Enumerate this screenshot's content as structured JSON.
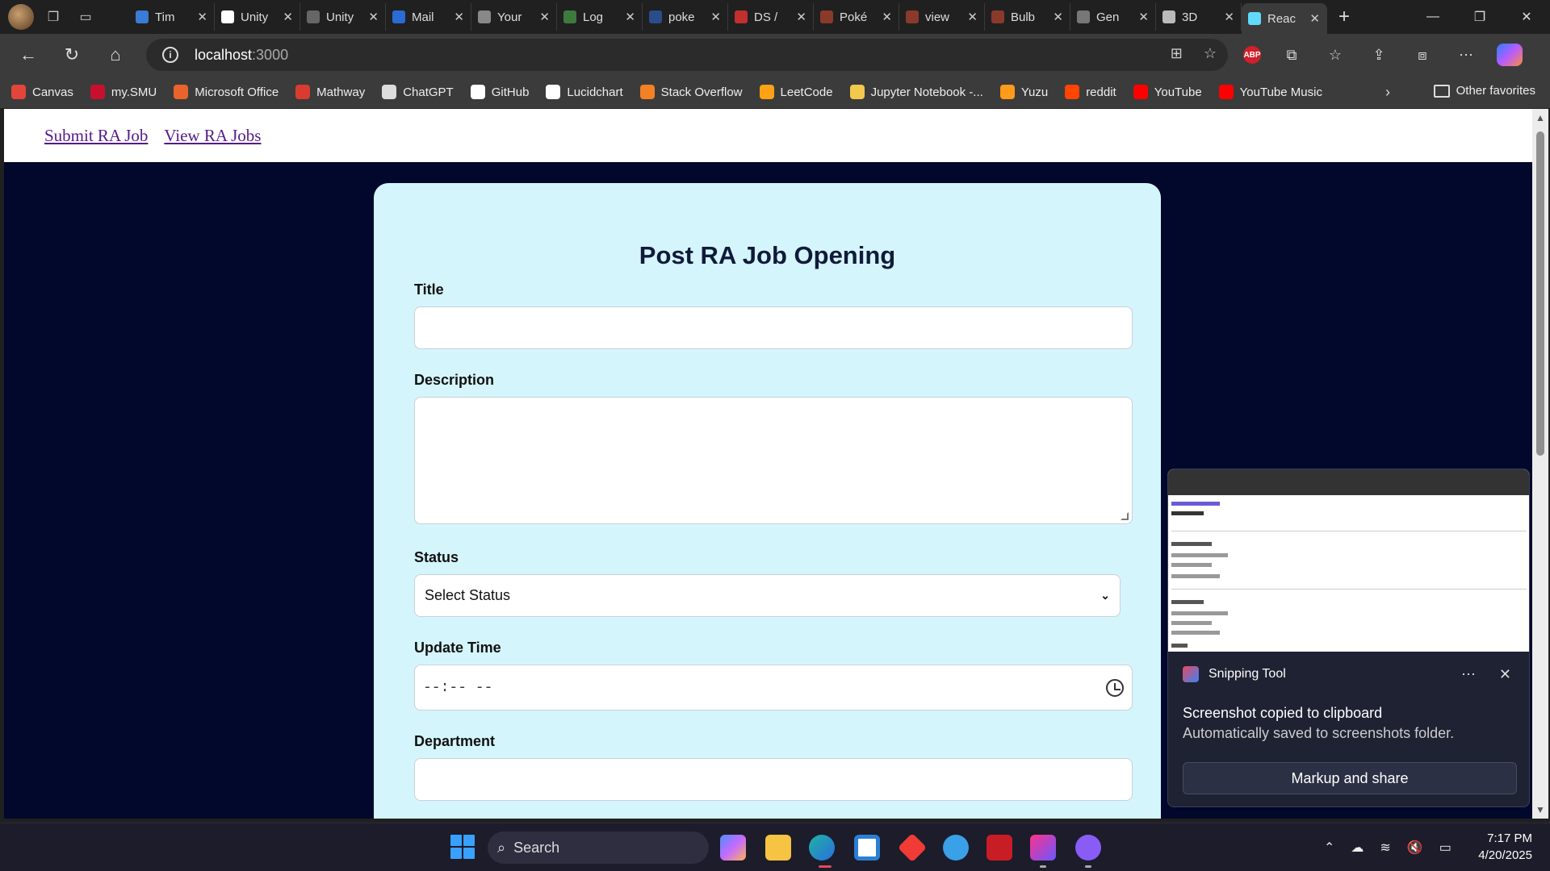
{
  "browser": {
    "tabs": [
      {
        "label": "Tim",
        "color": "#3a7bd5"
      },
      {
        "label": "Unity",
        "color": "#ffffff"
      },
      {
        "label": "Unity",
        "color": "#666666"
      },
      {
        "label": "Mail",
        "color": "#2b6bd6"
      },
      {
        "label": "Your",
        "color": "#888888"
      },
      {
        "label": "Log",
        "color": "#3d7a3d"
      },
      {
        "label": "poke",
        "color": "#2a4c8a"
      },
      {
        "label": "DS /",
        "color": "#c22f2f"
      },
      {
        "label": "Poké",
        "color": "#8a3a2a"
      },
      {
        "label": "view",
        "color": "#8a3a2a"
      },
      {
        "label": "Bulb",
        "color": "#8a3a2a"
      },
      {
        "label": "Gen",
        "color": "#777777"
      },
      {
        "label": "3D",
        "color": "#bbbbbb"
      },
      {
        "label": "Reac",
        "color": "#61dafb",
        "active": true
      }
    ],
    "url_host": "localhost",
    "url_port": ":3000",
    "bookmarks": [
      {
        "label": "Canvas",
        "color": "#e4453a"
      },
      {
        "label": "my.SMU",
        "color": "#c8102e"
      },
      {
        "label": "Microsoft Office",
        "color": "#e8642c"
      },
      {
        "label": "Mathway",
        "color": "#d93b30"
      },
      {
        "label": "ChatGPT",
        "color": "#dddddd"
      },
      {
        "label": "GitHub",
        "color": "#ffffff"
      },
      {
        "label": "Lucidchart",
        "color": "#ffffff"
      },
      {
        "label": "Stack Overflow",
        "color": "#f48024"
      },
      {
        "label": "LeetCode",
        "color": "#ffa116"
      },
      {
        "label": "Jupyter Notebook -...",
        "color": "#f2c94c"
      },
      {
        "label": "Yuzu",
        "color": "#ff9b1a"
      },
      {
        "label": "reddit",
        "color": "#ff4500"
      },
      {
        "label": "YouTube",
        "color": "#ff0000"
      },
      {
        "label": "YouTube Music",
        "color": "#ff0000"
      }
    ],
    "other_favorites": "Other favorites"
  },
  "page": {
    "nav": {
      "submit": "Submit RA Job",
      "view": "View RA Jobs"
    },
    "form": {
      "heading": "Post RA Job Opening",
      "title_label": "Title",
      "title_value": "",
      "description_label": "Description",
      "description_value": "",
      "status_label": "Status",
      "status_selected": "Select Status",
      "update_time_label": "Update Time",
      "update_time_value": "--:-- --",
      "department_label": "Department",
      "department_value": ""
    }
  },
  "notification": {
    "app": "Snipping Tool",
    "line1": "Screenshot copied to clipboard",
    "line2": "Automatically saved to screenshots folder.",
    "button": "Markup and share"
  },
  "taskbar": {
    "search": "Search",
    "time": "7:17 PM",
    "date": "4/20/2025"
  }
}
